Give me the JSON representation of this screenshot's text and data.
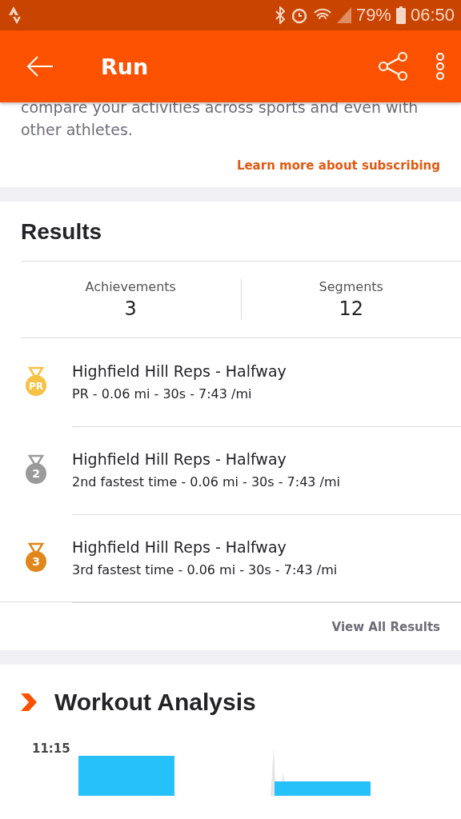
{
  "status_bar": {
    "battery": "79%",
    "time": "06:50"
  },
  "app_bar": {
    "title": "Run"
  },
  "promo": {
    "text": "compare your activities across sports and even with other athletes.",
    "link": "Learn more about subscribing"
  },
  "results": {
    "title": "Results",
    "stats": [
      {
        "label": "Achievements",
        "value": "3"
      },
      {
        "label": "Segments",
        "value": "12"
      }
    ],
    "items": [
      {
        "kind": "pr",
        "badge": "PR",
        "name": "Highfield Hill Reps - Halfway",
        "detail": "PR - 0.06 mi - 30s - 7:43 /mi"
      },
      {
        "kind": "silver",
        "badge": "2",
        "name": "Highfield Hill Reps - Halfway",
        "detail": "2nd fastest time - 0.06 mi - 30s - 7:43 /mi"
      },
      {
        "kind": "bronze",
        "badge": "3",
        "name": "Highfield Hill Reps - Halfway",
        "detail": "3rd fastest time - 0.06 mi - 30s - 7:43 /mi"
      }
    ],
    "view_all": "View All Results"
  },
  "workout": {
    "title": "Workout Analysis",
    "tick": "11:15"
  }
}
